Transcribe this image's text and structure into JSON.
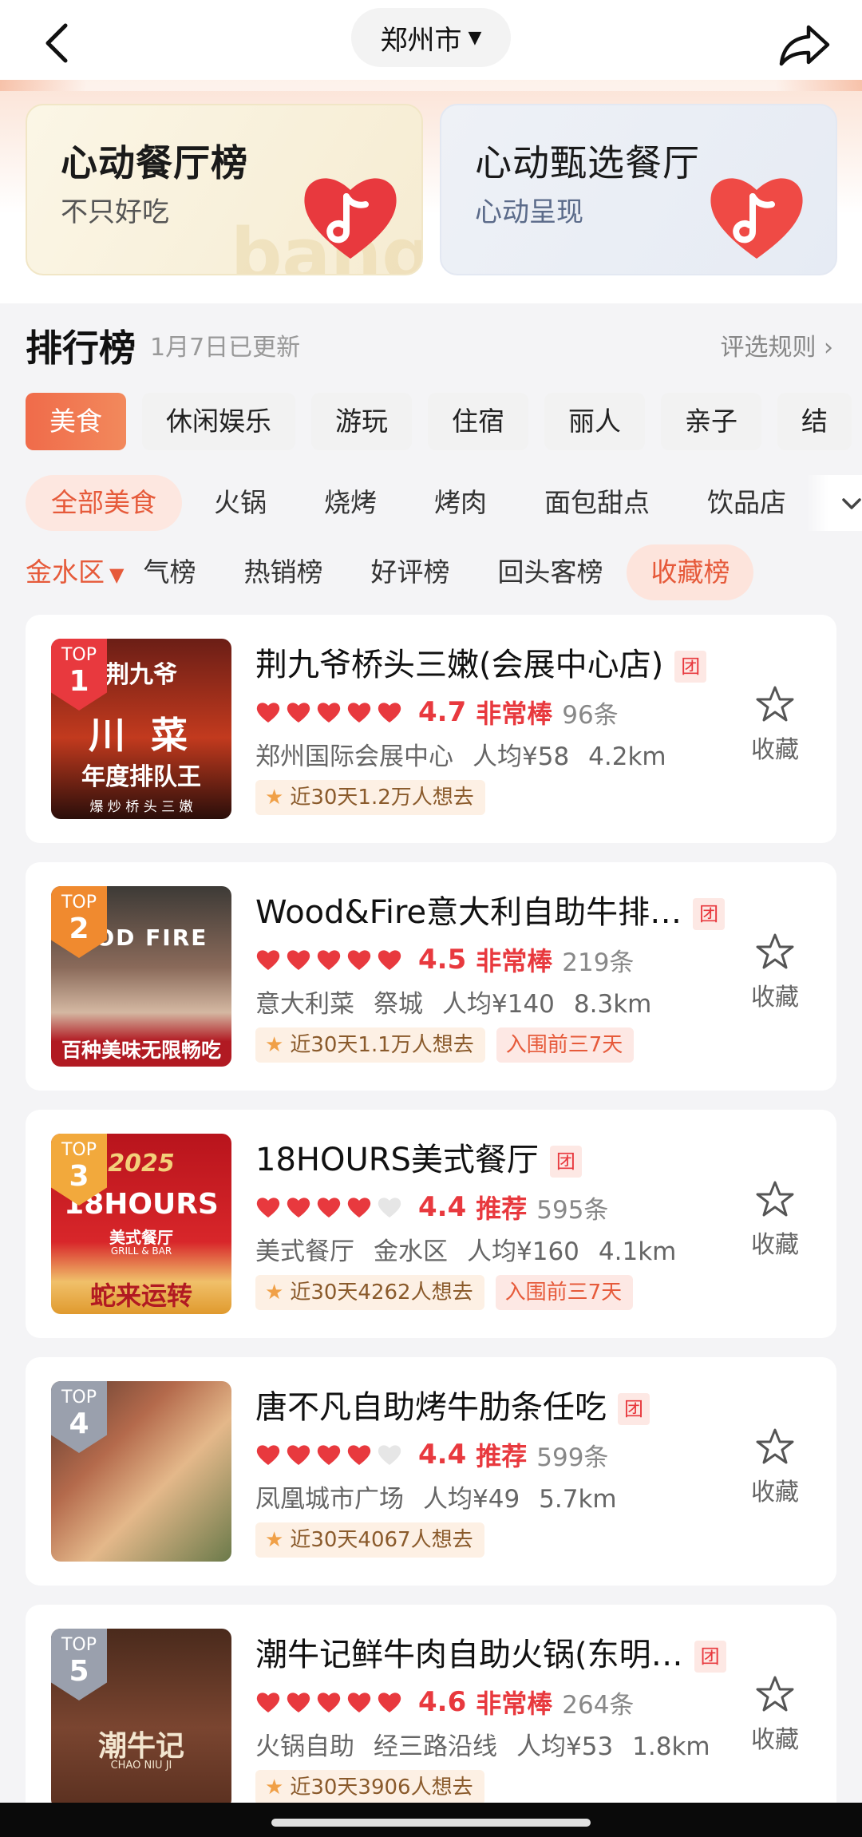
{
  "header": {
    "city": "郑州市"
  },
  "banners": {
    "left": {
      "title": "心动餐厅榜",
      "subtitle": "不只好吃",
      "watermark": "bang!"
    },
    "right": {
      "title": "心动甄选餐厅",
      "subtitle": "心动呈现"
    }
  },
  "ranking": {
    "title": "排行榜",
    "updated": "1月7日已更新",
    "rules": "评选规则 ›"
  },
  "categories": [
    "美食",
    "休闲娱乐",
    "游玩",
    "住宿",
    "丽人",
    "亲子",
    "结"
  ],
  "subcategories": [
    "全部美食",
    "火锅",
    "烧烤",
    "烤肉",
    "面包甜点",
    "饮品店"
  ],
  "list_types": {
    "region": "金水区",
    "items": [
      "气榜",
      "热销榜",
      "好评榜",
      "回头客榜",
      "收藏榜"
    ]
  },
  "restaurants": [
    {
      "rank": "1",
      "top": "TOP",
      "name": "荆九爷桥头三嫩(会展中心店)",
      "tuan": "团",
      "score": "4.7",
      "grade": "非常棒",
      "count": "96条",
      "meta": [
        "郑州国际会展中心",
        "人均¥58",
        "4.2km"
      ],
      "want": "近30天1.2万人想去",
      "extra_tag": "",
      "fav": "收藏",
      "thumb_lines": [
        "荆九爷",
        "川 菜",
        "年度排队王",
        "爆 炒 桥 头 三 嫩"
      ],
      "hearts": 5
    },
    {
      "rank": "2",
      "top": "TOP",
      "name": "Wood&Fire意大利自助牛排…",
      "tuan": "团",
      "score": "4.5",
      "grade": "非常棒",
      "count": "219条",
      "meta": [
        "意大利菜",
        "祭城",
        "人均¥140",
        "8.3km"
      ],
      "want": "近30天1.1万人想去",
      "extra_tag": "入围前三7天",
      "fav": "收藏",
      "thumb_lines": [
        "OOD FIRE",
        "百种美味无限畅吃"
      ],
      "hearts": 5
    },
    {
      "rank": "3",
      "top": "TOP",
      "name": "18HOURS美式餐厅",
      "tuan": "团",
      "score": "4.4",
      "grade": "推荐",
      "count": "595条",
      "meta": [
        "美式餐厅",
        "金水区",
        "人均¥160",
        "4.1km"
      ],
      "want": "近30天4262人想去",
      "extra_tag": "入围前三7天",
      "fav": "收藏",
      "thumb_lines": [
        "2025",
        "18HOURS",
        "美式餐厅",
        "GRILL & BAR",
        "蛇来运转"
      ],
      "hearts": 4
    },
    {
      "rank": "4",
      "top": "TOP",
      "name": "唐不凡自助烤牛肋条任吃",
      "tuan": "团",
      "score": "4.4",
      "grade": "推荐",
      "count": "599条",
      "meta": [
        "凤凰城市广场",
        "人均¥49",
        "5.7km"
      ],
      "want": "近30天4067人想去",
      "extra_tag": "",
      "fav": "收藏",
      "thumb_lines": [],
      "hearts": 4
    },
    {
      "rank": "5",
      "top": "TOP",
      "name": "潮牛记鲜牛肉自助火锅(东明…",
      "tuan": "团",
      "score": "4.6",
      "grade": "非常棒",
      "count": "264条",
      "meta": [
        "火锅自助",
        "经三路沿线",
        "人均¥53",
        "1.8km"
      ],
      "want": "近30天3906人想去",
      "extra_tag": "",
      "fav": "收藏",
      "thumb_lines": [
        "潮牛记",
        "CHAO NIU JI"
      ],
      "hearts": 5
    }
  ],
  "colors": {
    "accent": "#e8393e",
    "accent_orange": "#f06b4a",
    "bg": "#f4f4f6"
  }
}
